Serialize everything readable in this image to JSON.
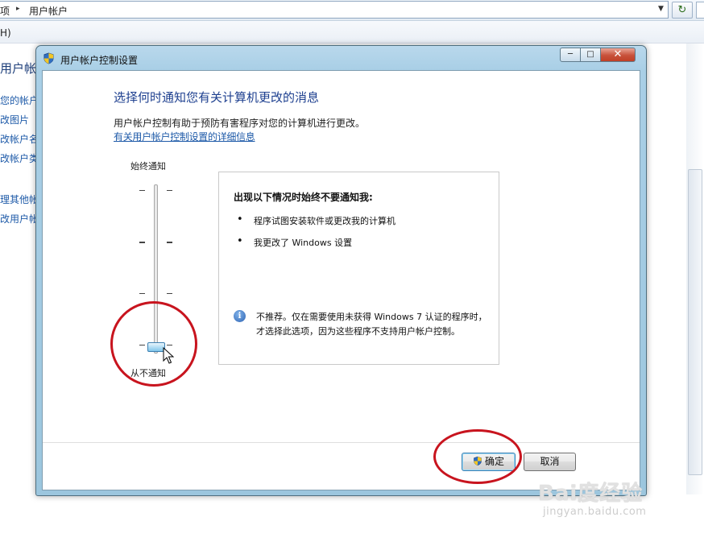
{
  "explorer": {
    "breadcrumb_start": "项",
    "breadcrumb_current": "用户帐户",
    "menu_fragment": "H)",
    "left_pane": {
      "title": "用户帐",
      "links": [
        "您的帐户",
        "改图片",
        "改帐户名",
        "改帐户类",
        "理其他帐",
        "改用户帐"
      ]
    }
  },
  "dialog": {
    "title": "用户帐户控制设置",
    "heading": "选择何时通知您有关计算机更改的消息",
    "description": "用户帐户控制有助于预防有害程序对您的计算机进行更改。",
    "details_link": "有关用户帐户控制设置的详细信息",
    "slider": {
      "top_label": "始终通知",
      "bottom_label": "从不通知",
      "levels": 4,
      "selected_level": 1
    },
    "info_box": {
      "heading": "出现以下情况时始终不要通知我:",
      "bullets": [
        "程序试图安装软件或更改我的计算机",
        "我更改了 Windows 设置"
      ],
      "note": "不推荐。仅在需要使用未获得 Windows 7 认证的程序时，才选择此选项，因为这些程序不支持用户帐户控制。"
    },
    "buttons": {
      "ok": "确定",
      "cancel": "取消"
    }
  },
  "watermark": {
    "logo": "Bai度经验",
    "url": "jingyan.baidu.com"
  },
  "colors": {
    "heading_blue": "#1d3f8f",
    "link_blue": "#1e5aa8",
    "annotation_red": "#c8141e"
  }
}
